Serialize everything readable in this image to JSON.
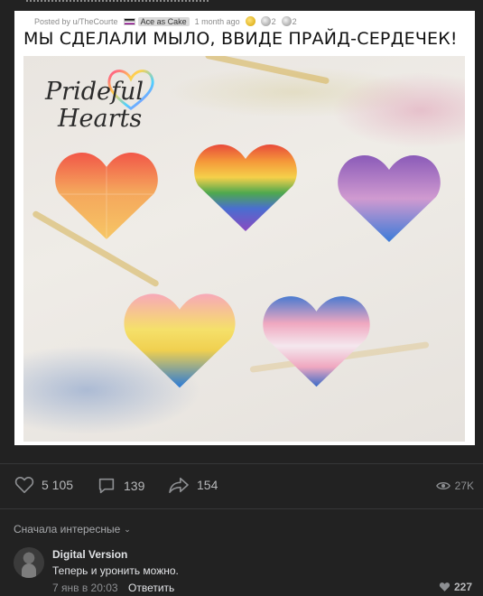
{
  "post": {
    "meta": {
      "posted_by": "Posted by u/TheCourte",
      "flair": "Ace as Cake",
      "ago": "1 month ago",
      "award_count_1": "2",
      "award_count_2": "2"
    },
    "headline": "МЫ СДЕЛАЛИ МЫЛО, ВВИДЕ ПРАЙД-СЕРДЕЧЕК!",
    "logo": {
      "line1": "Prideful",
      "line2": "Hearts"
    }
  },
  "actions": {
    "likes": "5 105",
    "comments": "139",
    "shares": "154",
    "views": "27K"
  },
  "comments_section": {
    "sort_label": "Сначала интересные",
    "items": [
      {
        "author": "Digital Version",
        "text": "Теперь и уронить можно.",
        "date": "7 янв в 20:03",
        "reply": "Ответить",
        "likes": "227"
      }
    ]
  },
  "colors": {
    "background": "#222222",
    "text_primary": "#e1e3e6",
    "text_secondary": "#8d8f92"
  },
  "icons": [
    "heart-icon",
    "comment-icon",
    "share-icon",
    "eye-icon",
    "chevron-down-icon"
  ]
}
